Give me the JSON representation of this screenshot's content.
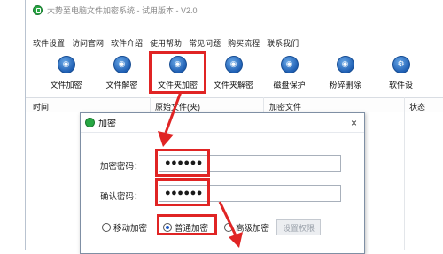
{
  "window": {
    "title": "大势至电脑文件加密系统 - 试用版本 - V2.0"
  },
  "menu": [
    "软件设置",
    "访问官网",
    "软件介绍",
    "使用帮助",
    "常见问题",
    "购买流程",
    "联系我们"
  ],
  "toolbar": [
    {
      "label": "文件加密",
      "icon": "file-lock-icon",
      "active": false
    },
    {
      "label": "文件解密",
      "icon": "file-unlock-icon",
      "active": false
    },
    {
      "label": "文件夹加密",
      "icon": "folder-lock-icon",
      "active": true
    },
    {
      "label": "文件夹解密",
      "icon": "folder-unlock-icon",
      "active": false
    },
    {
      "label": "磁盘保护",
      "icon": "disk-protect-icon",
      "active": false
    },
    {
      "label": "粉碎删除",
      "icon": "shred-icon",
      "active": false
    },
    {
      "label": "软件设",
      "icon": "settings-icon",
      "active": false
    }
  ],
  "grid": {
    "columns": [
      "时间",
      "原始文件(夹)",
      "加密文件",
      "状态"
    ]
  },
  "dialog": {
    "title": "加密",
    "close": "×",
    "password_label": "加密密码：",
    "password_value": "●●●●●●",
    "confirm_label": "确认密码：",
    "confirm_value": "●●●●●●",
    "options": [
      {
        "label": "移动加密",
        "selected": false
      },
      {
        "label": "普通加密",
        "selected": true
      },
      {
        "label": "高级加密",
        "selected": false
      }
    ],
    "perm_button": "设置权限"
  },
  "colors": {
    "highlight": "#e02424",
    "accent": "#1f5fb3"
  }
}
